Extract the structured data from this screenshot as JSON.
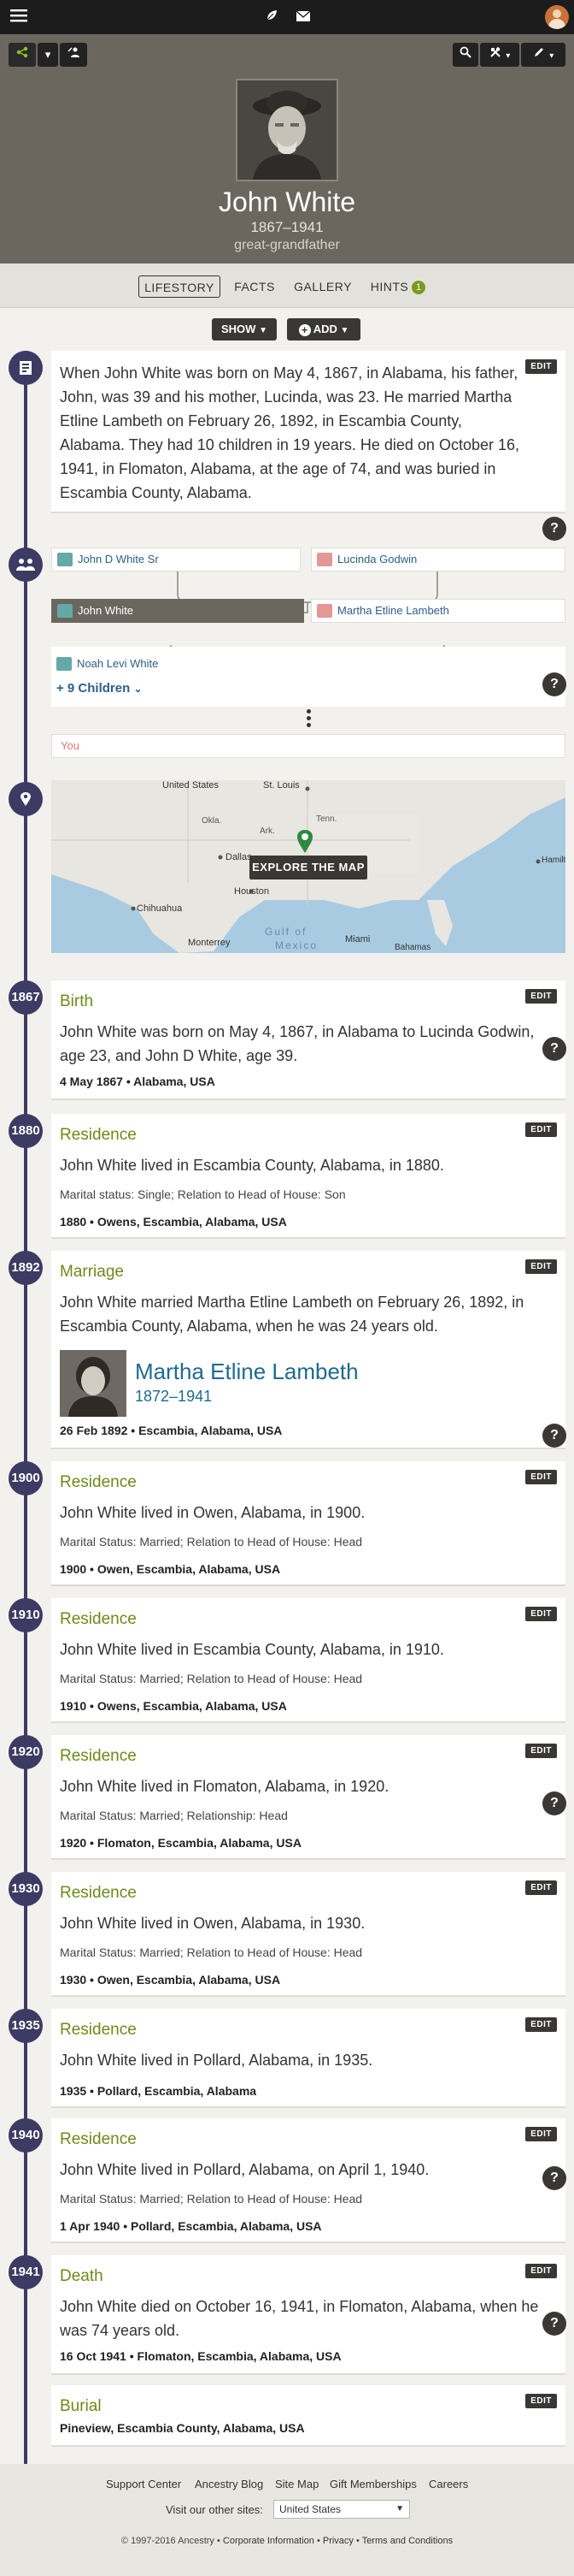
{
  "topbar": {
    "icons": [
      "menu-icon",
      "leaf-icon",
      "mail-icon",
      "avatar"
    ]
  },
  "hero": {
    "name": "John White",
    "years": "1867–1941",
    "relationship": "great-grandfather"
  },
  "tabs": [
    {
      "label": "LIFESTORY",
      "active": true
    },
    {
      "label": "FACTS"
    },
    {
      "label": "GALLERY"
    },
    {
      "label": "HINTS",
      "badge": "1"
    }
  ],
  "actions": {
    "show": "SHOW",
    "add": "ADD"
  },
  "story": {
    "edit": "EDIT",
    "text": "When John White was born on May 4, 1867, in Alabama, his father, John, was 39 and his mother, Lucinda, was 23. He married Martha Etline Lambeth on February 26, 1892, in Escambia County, Alabama. They had 10 children in 19 years. He died on October 16, 1941, in Flomaton, Alabama, at the age of 74, and was buried in Escambia County, Alabama."
  },
  "family": {
    "father": "John D White Sr",
    "mother": "Lucinda Godwin",
    "self": "John White",
    "spouse": "Martha Etline Lambeth",
    "child": "Noah Levi White",
    "more_children": "+ 9 Children",
    "you": "You"
  },
  "map": {
    "explore": "EXPLORE THE MAP",
    "labels": [
      "United States",
      "St. Louis",
      "Okla.",
      "Ark.",
      "Tenn.",
      "Dallas",
      "Houston",
      "Chihuahua",
      "Monterrey",
      "Gulf of",
      "Mexico",
      "Miami",
      "Bahamas",
      "Hamilton"
    ]
  },
  "events": [
    {
      "year": "1867",
      "type": "Birth",
      "desc": "John White was born on May 4, 1867, in Alabama to Lucinda Godwin, age 23, and John D White, age 39.",
      "date": "4 May 1867 • Alabama, USA",
      "edit": "EDIT"
    },
    {
      "year": "1880",
      "type": "Residence",
      "desc": "John White lived in Escambia County, Alabama, in 1880.",
      "note": "Marital status: Single; Relation to Head of House: Son",
      "date": "1880 • Owens, Escambia, Alabama, USA",
      "edit": "EDIT"
    },
    {
      "year": "1892",
      "type": "Marriage",
      "desc": "John White married Martha Etline Lambeth on February 26, 1892, in Escambia County, Alabama, when he was 24 years old.",
      "spouse_name": "Martha Etline Lambeth",
      "spouse_years": "1872–1941",
      "date": "26 Feb 1892 • Escambia, Alabama, USA",
      "edit": "EDIT"
    },
    {
      "year": "1900",
      "type": "Residence",
      "desc": "John White lived in Owen, Alabama, in 1900.",
      "note": "Marital Status: Married; Relation to Head of House: Head",
      "date": "1900 • Owen, Escambia, Alabama, USA",
      "edit": "EDIT"
    },
    {
      "year": "1910",
      "type": "Residence",
      "desc": "John White lived in Escambia County, Alabama, in 1910.",
      "note": "Marital Status: Married; Relation to Head of House: Head",
      "date": "1910 • Owens, Escambia, Alabama, USA",
      "edit": "EDIT"
    },
    {
      "year": "1920",
      "type": "Residence",
      "desc": "John White lived in Flomaton, Alabama, in 1920.",
      "note": "Marital Status: Married; Relationship: Head",
      "date": "1920 • Flomaton, Escambia, Alabama, USA",
      "edit": "EDIT"
    },
    {
      "year": "1930",
      "type": "Residence",
      "desc": "John White lived in Owen, Alabama, in 1930.",
      "note": "Marital Status: Married; Relation to Head of House: Head",
      "date": "1930 • Owen, Escambia, Alabama, USA",
      "edit": "EDIT"
    },
    {
      "year": "1935",
      "type": "Residence",
      "desc": "John White lived in Pollard, Alabama, in 1935.",
      "date": "1935 • Pollard, Escambia, Alabama",
      "edit": "EDIT"
    },
    {
      "year": "1940",
      "type": "Residence",
      "desc": "John White lived in Pollard, Alabama, on April 1, 1940.",
      "note": "Marital Status: Married; Relation to Head of House: Head",
      "date": "1 Apr 1940 • Pollard, Escambia, Alabama, USA",
      "edit": "EDIT"
    },
    {
      "year": "1941",
      "type": "Death",
      "desc": "John White died on October 16, 1941, in Flomaton, Alabama, when he was 74 years old.",
      "date": "16 Oct 1941 • Flomaton, Escambia, Alabama, USA",
      "edit": "EDIT"
    },
    {
      "type": "Burial",
      "date": "Pineview, Escambia County, Alabama, USA",
      "edit": "EDIT"
    }
  ],
  "footer": {
    "links": [
      "Support Center",
      "Ancestry Blog",
      "Site Map",
      "Gift Memberships",
      "Careers"
    ],
    "other_sites_label": "Visit our other sites:",
    "other_sites_value": "United States",
    "copyright": "© 1997-2016 Ancestry",
    "legal": [
      "Corporate Information",
      "Privacy",
      "Terms and Conditions"
    ]
  },
  "colors": {
    "timeline": "#3d3a63",
    "event_title": "#6e8a18",
    "link": "#2c5f8a",
    "hint_badge": "#7a9a1e"
  }
}
